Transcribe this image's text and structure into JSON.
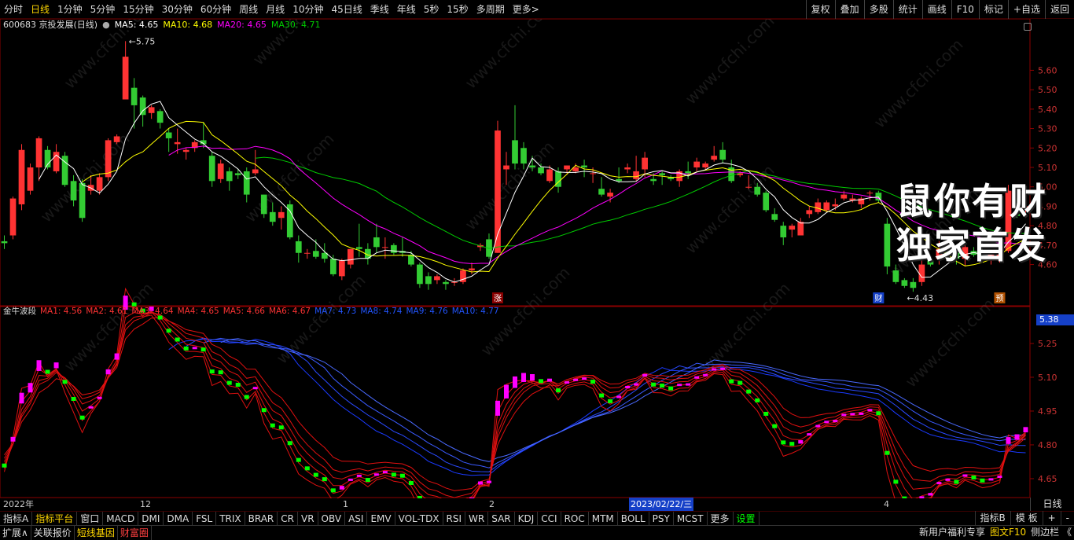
{
  "toolbar": {
    "periods": [
      "分时",
      "日线",
      "1分钟",
      "5分钟",
      "15分钟",
      "30分钟",
      "60分钟",
      "周线",
      "月线",
      "10分钟",
      "45日线",
      "季线",
      "年线",
      "5秒",
      "15秒",
      "多周期",
      "更多>"
    ],
    "active": "日线",
    "right": [
      "复权",
      "叠加",
      "多股",
      "统计",
      "画线",
      "F10",
      "标记",
      "+自选",
      "返回"
    ]
  },
  "stock": {
    "title": "600683 京投发展(日线)",
    "ma5": "MA5: 4.65",
    "ma10": "MA10: 4.68",
    "ma20": "MA20: 4.65",
    "ma30": "MA30: 4.71",
    "high_label": "5.75",
    "low_label": "4.43",
    "marker_up": "涨",
    "marker_cai": "财",
    "marker_yu": "预"
  },
  "indicator": {
    "name": "金牛波段",
    "ma": [
      "MA1: 4.56",
      "MA2: 4.61",
      "MA3: 4.64",
      "MA4: 4.65",
      "MA5: 4.66",
      "MA6: 4.67",
      "MA7: 4.73",
      "MA8: 4.74",
      "MA9: 4.76",
      "MA10: 4.77"
    ]
  },
  "price_axis": [
    "5.60",
    "5.50",
    "5.40",
    "5.30",
    "5.20",
    "5.10",
    "5.00",
    "4.90",
    "4.80",
    "4.70",
    "4.60"
  ],
  "ind_axis": [
    "5.25",
    "5.10",
    "4.95",
    "4.80",
    "4.65"
  ],
  "current_price": "5.38",
  "time_labels": {
    "t0": "2022年",
    "t1": "12",
    "t2": "1",
    "t3": "2",
    "t4": "2023/02/22/三",
    "t5": "4"
  },
  "period_button": "日线",
  "tabs_row1": [
    "指标A",
    "指标平台",
    "窗口",
    "MACD",
    "DMI",
    "DMA",
    "FSL",
    "TRIX",
    "BRAR",
    "CR",
    "VR",
    "OBV",
    "ASI",
    "EMV",
    "VOL-TDX",
    "RSI",
    "WR",
    "SAR",
    "KDJ",
    "CCI",
    "ROC",
    "MTM",
    "BOLL",
    "PSY",
    "MCST",
    "更多",
    "设置"
  ],
  "tabs_row1_right": [
    "指标B",
    "模 板",
    "+",
    "-"
  ],
  "tabs_row2": [
    "扩展∧",
    "关联报价",
    "短线基因",
    "财富圈"
  ],
  "tabs_row2_right": [
    "新用户福利专享",
    "图文F10",
    "侧边栏 《"
  ],
  "promo": {
    "line1": "鼠你有财",
    "line2": "独家首发"
  },
  "watermark": "www.cfchi.com",
  "colors": {
    "up": "#ff3333",
    "down": "#33cc33",
    "ma5": "#ffffff",
    "ma10": "#ffff00",
    "ma20": "#ff00ff",
    "ma30": "#00cc00",
    "grid": "#5a0000"
  },
  "chart_data": {
    "type": "candlestick",
    "ylim": [
      4.4,
      5.8
    ],
    "candles": [
      [
        4.72,
        4.75,
        4.68,
        4.71
      ],
      [
        4.75,
        4.95,
        4.73,
        4.94
      ],
      [
        4.91,
        5.22,
        4.88,
        5.19
      ],
      [
        4.98,
        5.12,
        4.96,
        5.1
      ],
      [
        5.1,
        5.26,
        5.03,
        5.25
      ],
      [
        5.19,
        5.21,
        5.09,
        5.1
      ],
      [
        5.08,
        5.22,
        5.07,
        5.18
      ],
      [
        5.16,
        5.18,
        5.0,
        5.01
      ],
      [
        5.03,
        5.06,
        4.9,
        4.93
      ],
      [
        5.02,
        5.04,
        4.82,
        4.84
      ],
      [
        4.98,
        5.06,
        4.96,
        5.01
      ],
      [
        4.98,
        5.07,
        4.96,
        5.05
      ],
      [
        5.05,
        5.25,
        5.03,
        5.24
      ],
      [
        5.23,
        5.27,
        5.22,
        5.26
      ],
      [
        5.45,
        5.75,
        5.45,
        5.67
      ],
      [
        5.51,
        5.56,
        5.3,
        5.42
      ],
      [
        5.46,
        5.47,
        5.31,
        5.37
      ],
      [
        5.38,
        5.42,
        5.35,
        5.41
      ],
      [
        5.39,
        5.4,
        5.3,
        5.33
      ],
      [
        5.28,
        5.3,
        5.18,
        5.25
      ],
      [
        5.22,
        5.3,
        5.17,
        5.23
      ],
      [
        5.18,
        5.2,
        5.14,
        5.19
      ],
      [
        5.2,
        5.24,
        5.18,
        5.23
      ],
      [
        5.24,
        5.33,
        5.2,
        5.22
      ],
      [
        5.16,
        5.18,
        5.0,
        5.03
      ],
      [
        5.04,
        5.14,
        5.02,
        5.12
      ],
      [
        5.08,
        5.1,
        4.98,
        5.03
      ],
      [
        5.07,
        5.09,
        5.04,
        5.06
      ],
      [
        5.08,
        5.1,
        4.92,
        4.96
      ],
      [
        5.07,
        5.19,
        5.06,
        5.09
      ],
      [
        4.96,
        4.96,
        4.84,
        4.86
      ],
      [
        4.87,
        4.92,
        4.8,
        4.82
      ],
      [
        4.84,
        4.9,
        4.78,
        4.87
      ],
      [
        4.91,
        4.93,
        4.73,
        4.74
      ],
      [
        4.72,
        4.75,
        4.61,
        4.66
      ],
      [
        4.66,
        4.68,
        4.63,
        4.66
      ],
      [
        4.67,
        4.73,
        4.63,
        4.64
      ],
      [
        4.66,
        4.71,
        4.61,
        4.63
      ],
      [
        4.63,
        4.65,
        4.54,
        4.55
      ],
      [
        4.54,
        4.63,
        4.52,
        4.62
      ],
      [
        4.6,
        4.68,
        4.58,
        4.68
      ],
      [
        4.69,
        4.81,
        4.64,
        4.68
      ],
      [
        4.68,
        4.71,
        4.6,
        4.63
      ],
      [
        4.74,
        4.81,
        4.66,
        4.69
      ],
      [
        4.69,
        4.74,
        4.63,
        4.69
      ],
      [
        4.7,
        4.71,
        4.65,
        4.66
      ],
      [
        4.67,
        4.74,
        4.64,
        4.66
      ],
      [
        4.65,
        4.67,
        4.59,
        4.6
      ],
      [
        4.6,
        4.61,
        4.48,
        4.5
      ],
      [
        4.54,
        4.56,
        4.47,
        4.5
      ],
      [
        4.52,
        4.55,
        4.5,
        4.54
      ],
      [
        4.51,
        4.52,
        4.47,
        4.5
      ],
      [
        4.51,
        4.53,
        4.49,
        4.51
      ],
      [
        4.51,
        4.58,
        4.5,
        4.57
      ],
      [
        4.57,
        4.61,
        4.55,
        4.58
      ],
      [
        4.69,
        4.71,
        4.67,
        4.7
      ],
      [
        4.73,
        4.76,
        4.63,
        4.64
      ],
      [
        4.66,
        5.34,
        4.66,
        5.29
      ],
      [
        5.09,
        5.18,
        5.01,
        5.11
      ],
      [
        5.24,
        5.42,
        5.09,
        5.12
      ],
      [
        5.2,
        5.23,
        5.09,
        5.12
      ],
      [
        5.11,
        5.16,
        5.08,
        5.1
      ],
      [
        5.1,
        5.12,
        5.06,
        5.07
      ],
      [
        5.03,
        5.11,
        5.02,
        5.09
      ],
      [
        5.08,
        5.1,
        4.97,
        5.0
      ],
      [
        5.09,
        5.11,
        5.07,
        5.11
      ],
      [
        5.08,
        5.12,
        5.07,
        5.1
      ],
      [
        5.11,
        5.14,
        5.05,
        5.1
      ],
      [
        5.07,
        5.1,
        5.02,
        5.07
      ],
      [
        4.99,
        5.05,
        4.95,
        4.96
      ],
      [
        4.95,
        4.99,
        4.92,
        4.97
      ],
      [
        5.04,
        5.1,
        5.02,
        5.03
      ],
      [
        5.09,
        5.12,
        5.07,
        5.1
      ],
      [
        5.04,
        5.16,
        5.03,
        5.08
      ],
      [
        5.09,
        5.18,
        5.05,
        5.15
      ],
      [
        5.04,
        5.07,
        5.01,
        5.03
      ],
      [
        5.07,
        5.08,
        5.01,
        5.06
      ],
      [
        5.05,
        5.06,
        5.03,
        5.04
      ],
      [
        5.03,
        5.09,
        5.0,
        5.08
      ],
      [
        5.08,
        5.13,
        5.04,
        5.07
      ],
      [
        5.1,
        5.15,
        5.08,
        5.13
      ],
      [
        5.1,
        5.13,
        5.09,
        5.12
      ],
      [
        5.14,
        5.21,
        5.13,
        5.16
      ],
      [
        5.19,
        5.23,
        5.12,
        5.14
      ],
      [
        5.1,
        5.14,
        5.02,
        5.03
      ],
      [
        5.06,
        5.08,
        5.05,
        5.07
      ],
      [
        5.0,
        5.06,
        4.99,
        5.0
      ],
      [
        5.0,
        5.02,
        4.95,
        4.96
      ],
      [
        4.97,
        4.98,
        4.87,
        4.88
      ],
      [
        4.86,
        4.89,
        4.82,
        4.83
      ],
      [
        4.8,
        4.82,
        4.7,
        4.74
      ],
      [
        4.78,
        4.81,
        4.74,
        4.8
      ],
      [
        4.75,
        4.84,
        4.75,
        4.82
      ],
      [
        4.86,
        4.9,
        4.84,
        4.88
      ],
      [
        4.87,
        4.94,
        4.86,
        4.92
      ],
      [
        4.88,
        4.93,
        4.87,
        4.92
      ],
      [
        4.9,
        4.94,
        4.88,
        4.91
      ],
      [
        4.94,
        4.98,
        4.93,
        4.96
      ],
      [
        4.93,
        4.96,
        4.92,
        4.94
      ],
      [
        4.91,
        4.95,
        4.89,
        4.94
      ],
      [
        4.97,
        4.98,
        4.93,
        4.97
      ],
      [
        4.97,
        4.98,
        4.92,
        4.93
      ],
      [
        4.81,
        4.84,
        4.55,
        4.59
      ],
      [
        4.57,
        4.6,
        4.5,
        4.51
      ],
      [
        4.52,
        4.53,
        4.48,
        4.49
      ],
      [
        4.51,
        4.53,
        4.46,
        4.48
      ],
      [
        4.51,
        4.63,
        4.49,
        4.6
      ],
      [
        4.62,
        4.64,
        4.59,
        4.6
      ],
      [
        4.63,
        4.72,
        4.6,
        4.68
      ],
      [
        4.68,
        4.71,
        4.64,
        4.66
      ],
      [
        4.66,
        4.7,
        4.6,
        4.63
      ],
      [
        4.63,
        4.71,
        4.59,
        4.69
      ],
      [
        4.67,
        4.69,
        4.64,
        4.65
      ],
      [
        4.64,
        4.68,
        4.62,
        4.63
      ],
      [
        4.62,
        4.67,
        4.6,
        4.65
      ],
      [
        4.62,
        4.7,
        4.61,
        4.67
      ],
      [
        4.67,
        5.01,
        4.66,
        4.98
      ],
      [
        4.86,
        4.94,
        4.84,
        4.85
      ],
      [
        4.89,
        4.93,
        4.86,
        4.9
      ]
    ]
  }
}
